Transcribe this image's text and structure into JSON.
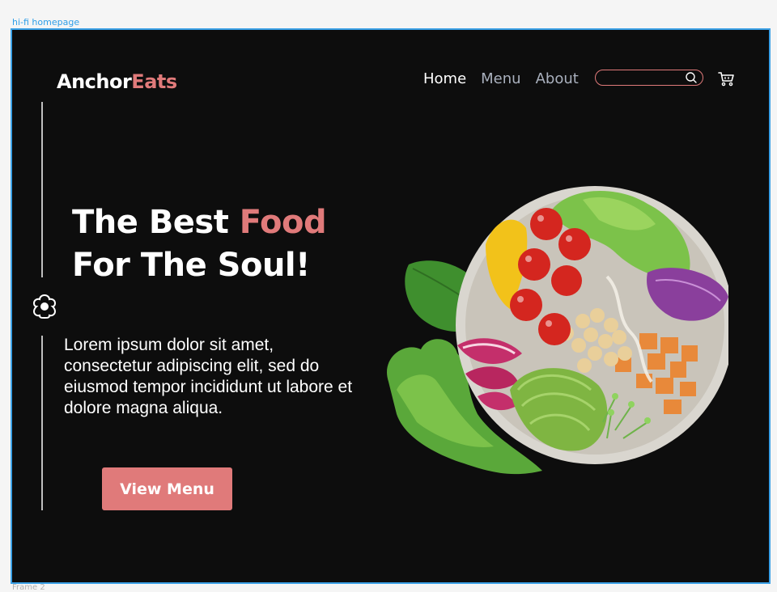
{
  "canvas": {
    "frame_label": "hi-fi homepage",
    "footer_label": "Frame 2"
  },
  "brand": {
    "name_part1": "Anchor",
    "name_part2": "Eats",
    "accent_color": "#e07a7a"
  },
  "nav": {
    "items": [
      {
        "label": "Home",
        "active": true
      },
      {
        "label": "Menu",
        "active": false
      },
      {
        "label": "About",
        "active": false
      }
    ]
  },
  "search": {
    "placeholder": "",
    "icon": "search-icon"
  },
  "cart": {
    "icon": "cart-icon"
  },
  "hero": {
    "headline_line1_a": "The Best ",
    "headline_line1_b": "Food",
    "headline_line2": "For The Soul!",
    "body": "Lorem ipsum dolor sit amet, consectetur adipiscing elit, sed do eiusmod tempor incididunt ut labore et dolore magna aliqua.",
    "cta_label": "View Menu",
    "side_icon": "flower-icon",
    "image": "salad-bowl-image"
  },
  "colors": {
    "background": "#0d0d0d",
    "accent": "#e07a7a",
    "nav_inactive": "#a9b0bd",
    "frame_border": "#3aa0e6"
  }
}
